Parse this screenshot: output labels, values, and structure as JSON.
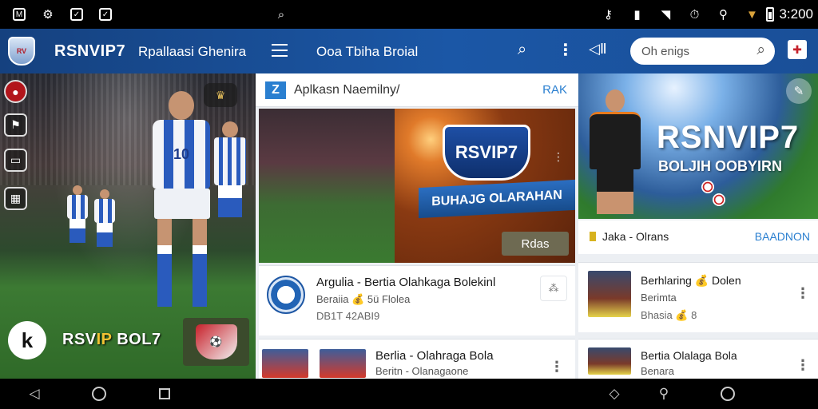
{
  "status_bar": {
    "time": "3:200"
  },
  "app_bar": {
    "brand": "RSNVIP7",
    "app_name": "Rpallaasi Ghenira",
    "title": "Ooa Tbiha Broial",
    "search_placeholder": "Oh enigs"
  },
  "hero_left": {
    "jersey_number": "10",
    "brand_part1": "RSV",
    "brand_part2": "IP",
    "brand_part3": " BOL7"
  },
  "middle": {
    "header_title": "Aplkasn Naemilny/",
    "header_action": "RAK",
    "promo_title": "RSVIP7",
    "promo_strip": "BUHAJG OLARAHAN",
    "promo_button": "Rdas",
    "card1": {
      "title": "Argulia - Bertia Olahkaga Bolekinl",
      "subtitle": "Beraiia 💰 5ü Flolea",
      "meta": "DB1T 42ABI9"
    },
    "card2": {
      "title": "Berlia - Olahraga Bola",
      "subtitle": "Beritn - Olanagaone"
    }
  },
  "right": {
    "hero_brand": "RSNVIP7",
    "hero_sub": "BOLJIH OOBYIRN",
    "section_title": "Jaka - Olrans",
    "section_action": "BAADNON",
    "card1": {
      "title": "Berhlaring 💰 Dolen",
      "subtitle": "Berimta",
      "meta": "Bhasia 💰 8"
    },
    "card2": {
      "title": "Bertia Olalaga Bola",
      "subtitle": "Benara"
    }
  },
  "colors": {
    "app_bar": "#1b57a6",
    "accent": "#2a7fd0",
    "brand_yellow": "#f1c232"
  }
}
